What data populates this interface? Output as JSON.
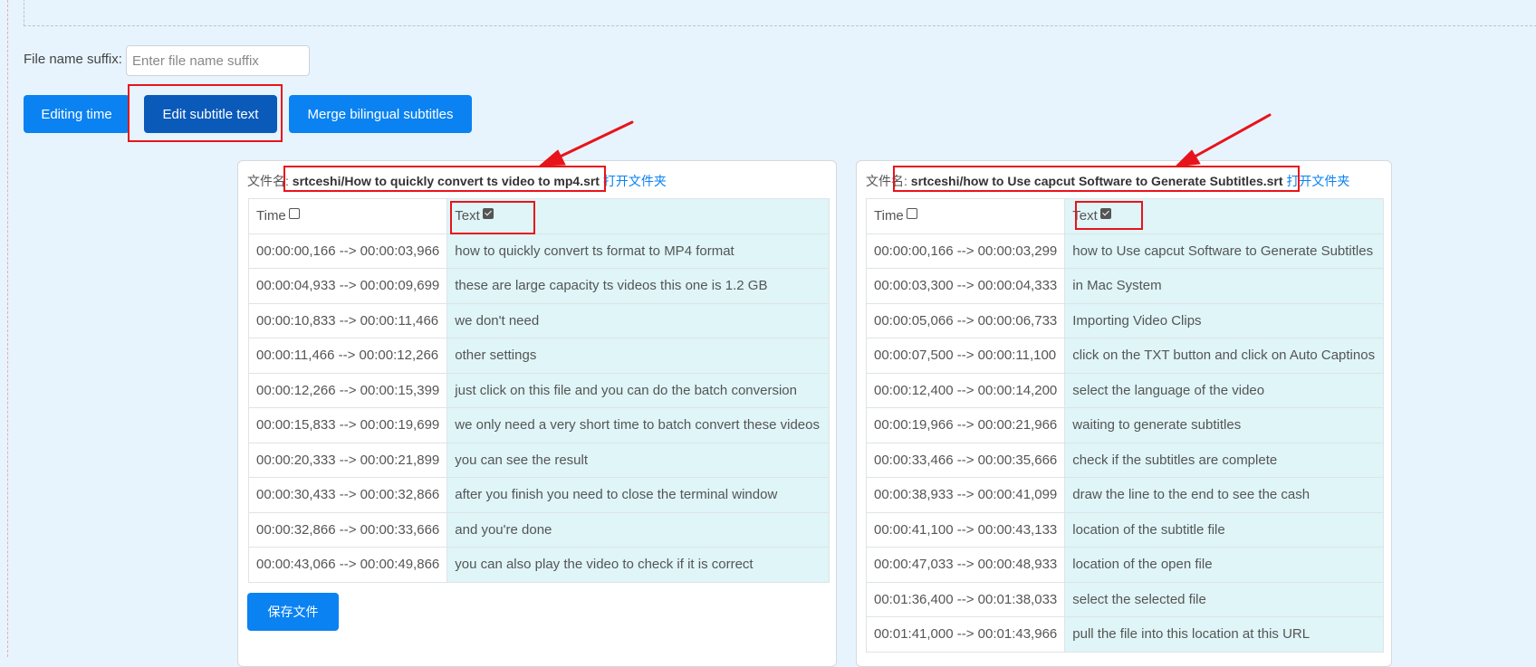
{
  "suffix": {
    "label": "File name suffix:",
    "placeholder": "Enter file name suffix",
    "value": ""
  },
  "buttons": {
    "editing_time": "Editing time",
    "edit_subtitle_text": "Edit subtitle text",
    "merge_bilingual": "Merge bilingual subtitles"
  },
  "panels": [
    {
      "filename_label": "文件名:",
      "filename": "srtceshi/How to quickly convert ts video to mp4.srt",
      "open_folder": "打开文件夹",
      "col_time": "Time",
      "col_text": "Text",
      "time_checked": false,
      "text_checked": true,
      "rows": [
        {
          "time": "00:00:00,166 --> 00:00:03,966",
          "text": "how to quickly convert ts format to MP4 format"
        },
        {
          "time": "00:00:04,933 --> 00:00:09,699",
          "text": "these are large capacity ts videos this one is 1.2 GB"
        },
        {
          "time": "00:00:10,833 --> 00:00:11,466",
          "text": "we don't need"
        },
        {
          "time": "00:00:11,466 --> 00:00:12,266",
          "text": "other settings"
        },
        {
          "time": "00:00:12,266 --> 00:00:15,399",
          "text": "just click on this file and you can do the batch conversion"
        },
        {
          "time": "00:00:15,833 --> 00:00:19,699",
          "text": "we only need a very short time to batch convert these videos"
        },
        {
          "time": "00:00:20,333 --> 00:00:21,899",
          "text": "you can see the result"
        },
        {
          "time": "00:00:30,433 --> 00:00:32,866",
          "text": "after you finish you need to close the terminal window"
        },
        {
          "time": "00:00:32,866 --> 00:00:33,666",
          "text": "and you're done"
        },
        {
          "time": "00:00:43,066 --> 00:00:49,866",
          "text": "you can also play the video to check if it is correct"
        }
      ],
      "save_label": "保存文件"
    },
    {
      "filename_label": "文件名:",
      "filename": "srtceshi/how to Use capcut Software to Generate Subtitles.srt",
      "open_folder": "打开文件夹",
      "col_time": "Time",
      "col_text": "Text",
      "time_checked": false,
      "text_checked": true,
      "rows": [
        {
          "time": "00:00:00,166 --> 00:00:03,299",
          "text": "how to Use capcut Software to Generate Subtitles"
        },
        {
          "time": "00:00:03,300 --> 00:00:04,333",
          "text": "in Mac System"
        },
        {
          "time": "00:00:05,066 --> 00:00:06,733",
          "text": "Importing Video Clips"
        },
        {
          "time": "00:00:07,500 --> 00:00:11,100",
          "text": "click on the TXT button and click on Auto Captinos"
        },
        {
          "time": "00:00:12,400 --> 00:00:14,200",
          "text": "select the language of the video"
        },
        {
          "time": "00:00:19,966 --> 00:00:21,966",
          "text": "waiting to generate subtitles"
        },
        {
          "time": "00:00:33,466 --> 00:00:35,666",
          "text": "check if the subtitles are complete"
        },
        {
          "time": "00:00:38,933 --> 00:00:41,099",
          "text": "draw the line to the end to see the cash"
        },
        {
          "time": "00:00:41,100 --> 00:00:43,133",
          "text": "location of the subtitle file"
        },
        {
          "time": "00:00:47,033 --> 00:00:48,933",
          "text": "location of the open file"
        },
        {
          "time": "00:01:36,400 --> 00:01:38,033",
          "text": "select the selected file"
        },
        {
          "time": "00:01:41,000 --> 00:01:43,966",
          "text": "pull the file into this location at this URL"
        }
      ]
    }
  ],
  "annotation_color": "#e8141b",
  "accent_color": "#0a82f2"
}
